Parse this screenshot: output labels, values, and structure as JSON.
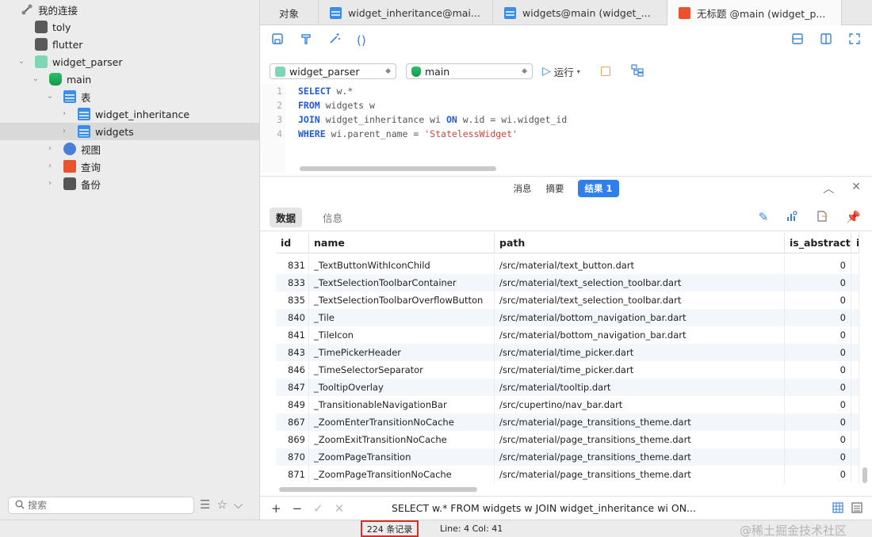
{
  "sidebar": {
    "root": "我的连接",
    "connections": [
      "toly",
      "flutter",
      "widget_parser"
    ],
    "database": "main",
    "tables_group": "表",
    "tables": [
      "widget_inheritance",
      "widgets"
    ],
    "groups": [
      "视图",
      "查询",
      "备份"
    ],
    "search_placeholder": "搜索"
  },
  "tabs": [
    {
      "label": "对象"
    },
    {
      "label": "widget_inheritance@mai..."
    },
    {
      "label": "widgets@main (widget_..."
    },
    {
      "label": "无标题 @main (widget_p..."
    }
  ],
  "selectors": {
    "connection": "widget_parser",
    "database": "main",
    "run_label": "运行"
  },
  "editor": {
    "line_numbers": [
      "1",
      "2",
      "3",
      "4"
    ],
    "lines": [
      {
        "kw1": "SELECT",
        "rest": " w.*"
      },
      {
        "kw1": "FROM",
        "rest": " widgets w"
      },
      {
        "kw1": "JOIN",
        "rest": " widget_inheritance wi ",
        "kw2": "ON",
        "rest2": " w.id = wi.widget_id"
      },
      {
        "kw1": "WHERE",
        "rest": " wi.parent_name = ",
        "str": "'StatelessWidget'"
      }
    ]
  },
  "result_tabs": {
    "messages": "消息",
    "summary": "摘要",
    "result": "结果 1"
  },
  "data_tabs": {
    "data": "数据",
    "info": "信息"
  },
  "columns": [
    "id",
    "name",
    "path",
    "is_abstract",
    "i"
  ],
  "rows": [
    {
      "id": "831",
      "name": "_TextButtonWithIconChild",
      "path": "/src/material/text_button.dart",
      "is_abstract": "0"
    },
    {
      "id": "833",
      "name": "_TextSelectionToolbarContainer",
      "path": "/src/material/text_selection_toolbar.dart",
      "is_abstract": "0"
    },
    {
      "id": "835",
      "name": "_TextSelectionToolbarOverflowButton",
      "path": "/src/material/text_selection_toolbar.dart",
      "is_abstract": "0"
    },
    {
      "id": "840",
      "name": "_Tile",
      "path": "/src/material/bottom_navigation_bar.dart",
      "is_abstract": "0"
    },
    {
      "id": "841",
      "name": "_TileIcon",
      "path": "/src/material/bottom_navigation_bar.dart",
      "is_abstract": "0"
    },
    {
      "id": "843",
      "name": "_TimePickerHeader",
      "path": "/src/material/time_picker.dart",
      "is_abstract": "0"
    },
    {
      "id": "846",
      "name": "_TimeSelectorSeparator",
      "path": "/src/material/time_picker.dart",
      "is_abstract": "0"
    },
    {
      "id": "847",
      "name": "_TooltipOverlay",
      "path": "/src/material/tooltip.dart",
      "is_abstract": "0"
    },
    {
      "id": "849",
      "name": "_TransitionableNavigationBar",
      "path": "/src/cupertino/nav_bar.dart",
      "is_abstract": "0"
    },
    {
      "id": "867",
      "name": "_ZoomEnterTransitionNoCache",
      "path": "/src/material/page_transitions_theme.dart",
      "is_abstract": "0"
    },
    {
      "id": "869",
      "name": "_ZoomExitTransitionNoCache",
      "path": "/src/material/page_transitions_theme.dart",
      "is_abstract": "0"
    },
    {
      "id": "870",
      "name": "_ZoomPageTransition",
      "path": "/src/material/page_transitions_theme.dart",
      "is_abstract": "0"
    },
    {
      "id": "871",
      "name": "_ZoomPageTransitionNoCache",
      "path": "/src/material/page_transitions_theme.dart",
      "is_abstract": "0"
    }
  ],
  "footer": {
    "sql_preview": "SELECT w.* FROM widgets w JOIN widget_inheritance wi ON..."
  },
  "status": {
    "records": "224 条记录",
    "position": "Line: 4  Col: 41",
    "watermark": "@稀土掘金技术社区"
  },
  "colors": {
    "accent": "#2f80ed",
    "highlight_border": "#d93025"
  }
}
